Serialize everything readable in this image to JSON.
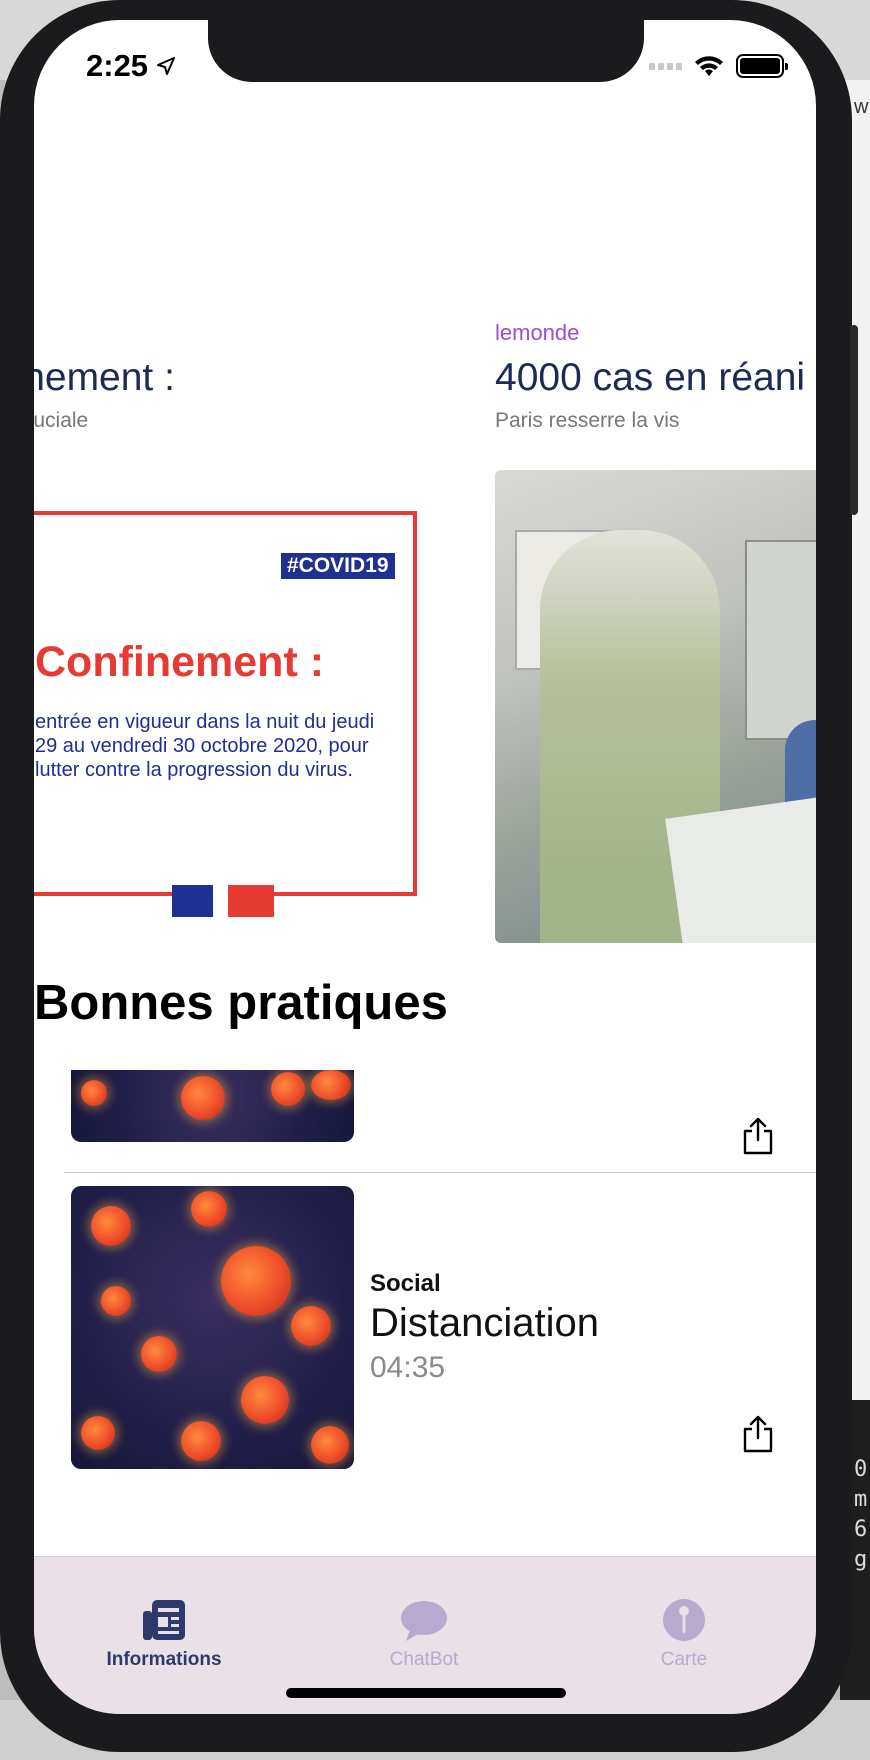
{
  "status_bar": {
    "time": "2:25",
    "icons": [
      "location-arrow-icon",
      "cellular-signal-icon",
      "wifi-icon",
      "battery-icon"
    ],
    "battery_level": 1.0
  },
  "news_carousel": [
    {
      "source": "",
      "title": "nfinement :",
      "subtitle": "ine cruciale",
      "image": {
        "tag": "#COVID19",
        "heading": "Confinement :",
        "body": "entrée en vigueur dans la nuit du jeudi 29 au vendredi 30 octobre 2020, pour lutter contre la progression du virus."
      }
    },
    {
      "source": "lemonde",
      "title": "4000 cas en réani",
      "subtitle": "Paris resserre la vis",
      "image": {
        "description_icon": "hospital-photo"
      }
    }
  ],
  "section": {
    "title": "Bonnes pratiques"
  },
  "practices": [
    {
      "category": "",
      "title": "",
      "duration": "",
      "share_icon": "share-icon"
    },
    {
      "category": "Social",
      "title": "Distanciation",
      "duration": "04:35",
      "share_icon": "share-icon"
    }
  ],
  "tabbar": {
    "tabs": [
      {
        "label": "Informations",
        "icon": "newspaper-icon",
        "active": true
      },
      {
        "label": "ChatBot",
        "icon": "chat-bubble-icon",
        "active": false
      },
      {
        "label": "Carte",
        "icon": "map-pin-icon",
        "active": false
      }
    ]
  },
  "colors": {
    "source_accent": "#9b4dd6",
    "headline": "#1c2a59",
    "tab_active": "#2e3a6e",
    "tab_inactive": "#b8a9cf",
    "tabbar_background": "#e9e0e8"
  },
  "desktop_fragments": {
    "right_edge_letter": "w",
    "code_fragments": [
      "0",
      "m",
      "6",
      "g"
    ]
  }
}
